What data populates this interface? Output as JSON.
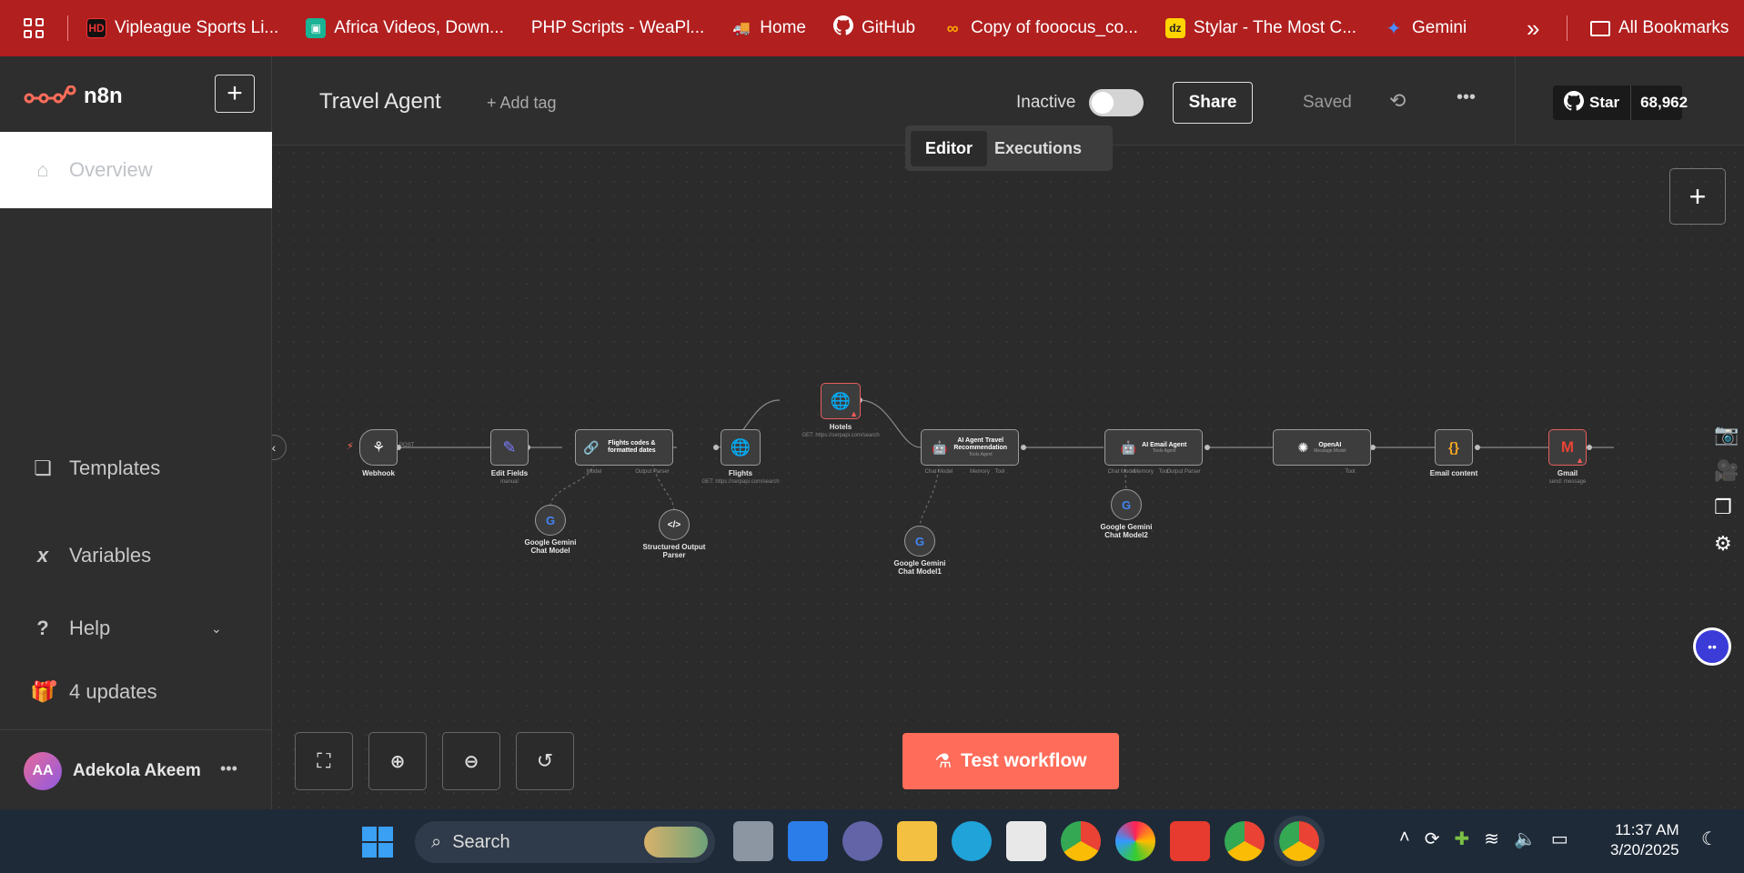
{
  "bookmarks": {
    "items": [
      {
        "label": "Vipleague Sports Li...",
        "icon": "vipleague-icon",
        "color": "#8b0000"
      },
      {
        "label": "Africa Videos, Down...",
        "icon": "africa-videos-icon",
        "color": "#19b394"
      },
      {
        "label": "PHP Scripts - WeaPl...",
        "icon": "",
        "color": ""
      },
      {
        "label": "Home",
        "icon": "truck-icon",
        "color": "#222"
      },
      {
        "label": "GitHub",
        "icon": "github-icon",
        "color": "#fff"
      },
      {
        "label": "Copy of fooocus_co...",
        "icon": "colab-icon",
        "color": "#f9ab00"
      },
      {
        "label": "Stylar - The Most C...",
        "icon": "stylar-icon",
        "color": "#ffd400"
      },
      {
        "label": "Gemini",
        "icon": "gemini-icon",
        "color": "#4a8cff"
      }
    ],
    "more": "»",
    "all_bookmarks": "All Bookmarks"
  },
  "sidebar": {
    "brand": "n8n",
    "add_button": "+",
    "overview": "Overview",
    "templates": "Templates",
    "variables": "Variables",
    "help": "Help",
    "updates": "4 updates",
    "user_initials": "AA",
    "user_name": "Adekola Akeem",
    "user_menu": "•••"
  },
  "header": {
    "workflow_name": "Travel Agent",
    "add_tag": "+ Add tag",
    "status_label": "Inactive",
    "active": false,
    "share": "Share",
    "saved": "Saved",
    "star": "Star",
    "star_count": "68,962",
    "tab_editor": "Editor",
    "tab_executions": "Executions"
  },
  "workflow": {
    "nodes": {
      "webhook": {
        "label": "Webhook",
        "sub": ""
      },
      "edit_fields": {
        "label": "Edit Fields",
        "sub": "manual"
      },
      "flights_codes": {
        "label": "Flights codes & formatted dates"
      },
      "flights": {
        "label": "Flights",
        "sub": "GET: https://serpapi.com/search"
      },
      "hotels": {
        "label": "Hotels",
        "sub": "GET: https://serpapi.com/search"
      },
      "ai_travel": {
        "label": "AI Agent Travel Recommendation",
        "sub": "Tools Agent"
      },
      "ai_email": {
        "label": "AI Email Agent",
        "sub": "Tools Agent"
      },
      "openai": {
        "label": "OpenAI",
        "sub": "Message Model"
      },
      "email_content": {
        "label": "Email content"
      },
      "gmail": {
        "label": "Gmail",
        "sub": "send: message"
      },
      "gemini1": {
        "label": "Google Gemini Chat Model"
      },
      "parser": {
        "label": "Structured Output Parser"
      },
      "gemini2": {
        "label": "Google Gemini Chat Model1"
      },
      "gemini3": {
        "label": "Google Gemini Chat Model2"
      }
    },
    "ports": {
      "model": "Model",
      "output_parser": "Output Parser",
      "chat_model": "Chat Model",
      "memory": "Memory",
      "tool": "Tool",
      "post": "POST"
    }
  },
  "footer": {
    "test_workflow": "Test workflow"
  },
  "taskbar": {
    "search": "Search",
    "time": "11:37 AM",
    "date": "3/20/2025"
  },
  "colors": {
    "brand_red": "#b11f1f",
    "n8n_accent": "#ff6d5a",
    "canvas_bg": "#2b2b2b"
  }
}
